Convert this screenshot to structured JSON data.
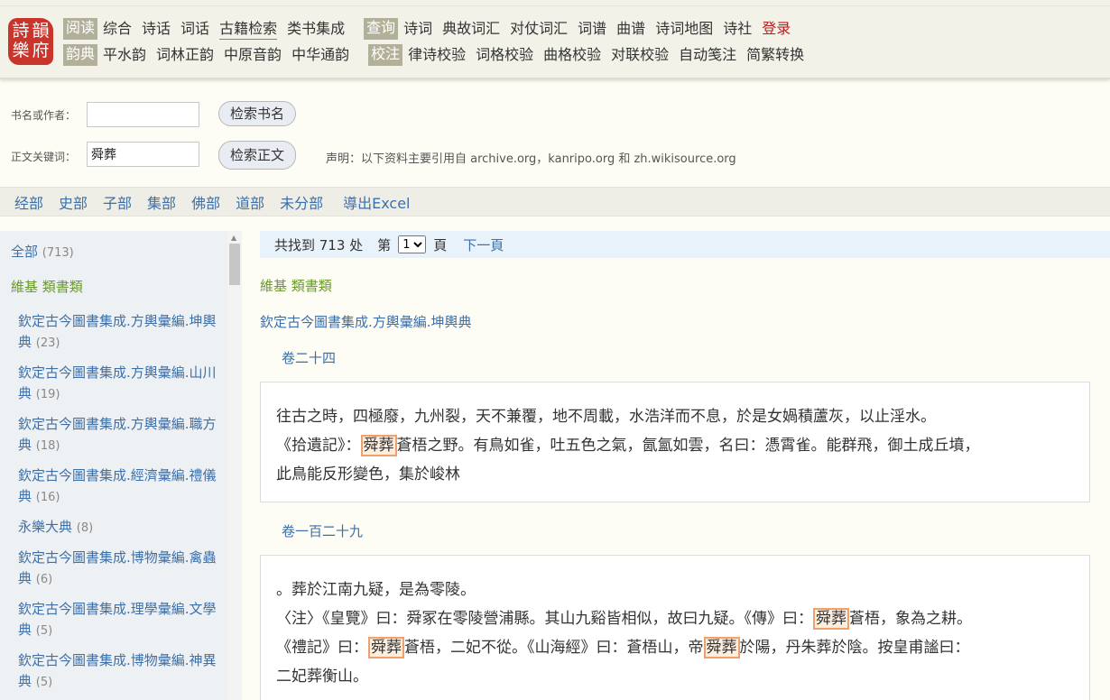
{
  "logo": {
    "glyphs": [
      "詩",
      "韻",
      "樂",
      "府"
    ]
  },
  "nav": {
    "row1": [
      {
        "label": "阅读",
        "pill": true
      },
      {
        "label": "综合"
      },
      {
        "label": "诗话"
      },
      {
        "label": "词话"
      },
      {
        "label": "古籍检索",
        "active": true
      },
      {
        "label": "类书集成"
      },
      {
        "label": "查询",
        "pill": true
      },
      {
        "label": "诗词"
      },
      {
        "label": "典故词汇"
      },
      {
        "label": "对仗词汇"
      },
      {
        "label": "词谱"
      },
      {
        "label": "曲谱"
      },
      {
        "label": "诗词地图"
      },
      {
        "label": "诗社"
      },
      {
        "label": "登录",
        "login": true
      }
    ],
    "row2": [
      {
        "label": "韵典",
        "pill": true
      },
      {
        "label": "平水韵"
      },
      {
        "label": "词林正韵"
      },
      {
        "label": "中原音韵"
      },
      {
        "label": "中华通韵"
      },
      {
        "label": "校注",
        "pill": true
      },
      {
        "label": "律诗校验"
      },
      {
        "label": "词格校验"
      },
      {
        "label": "曲格校验"
      },
      {
        "label": "对联校验"
      },
      {
        "label": "自动笺注"
      },
      {
        "label": "简繁转换"
      }
    ]
  },
  "search": {
    "title_label": "书名或作者：",
    "title_value": "",
    "title_button": "检索书名",
    "text_label": "正文关键词：",
    "text_value": "舜葬",
    "text_button": "检索正文",
    "notice": "声明：以下资料主要引用自 archive.org，kanripo.org 和 zh.wikisource.org"
  },
  "categories": [
    "经部",
    "史部",
    "子部",
    "集部",
    "佛部",
    "道部",
    "未分部"
  ],
  "export_label": "導出Excel",
  "sidebar": {
    "all_label": "全部",
    "all_count": "(713)",
    "group": "維基 類書類",
    "items": [
      {
        "name": "欽定古今圖書集成.方輿彙編.坤輿典",
        "count": "(23)"
      },
      {
        "name": "欽定古今圖書集成.方輿彙編.山川典",
        "count": "(19)"
      },
      {
        "name": "欽定古今圖書集成.方輿彙編.職方典",
        "count": "(18)"
      },
      {
        "name": "欽定古今圖書集成.經濟彙編.禮儀典",
        "count": "(16)"
      },
      {
        "name": "永樂大典",
        "count": "(8)"
      },
      {
        "name": "欽定古今圖書集成.博物彙編.禽蟲典",
        "count": "(6)"
      },
      {
        "name": "欽定古今圖書集成.理學彙編.文學典",
        "count": "(5)"
      },
      {
        "name": "欽定古今圖書集成.博物彙編.神異典",
        "count": "(5)"
      }
    ]
  },
  "results": {
    "found_prefix": "共找到 713 处",
    "page_prefix": "第",
    "page_value": "1",
    "page_suffix": "頁",
    "next_label": "下一頁",
    "group": "維基 類書類",
    "book": "欽定古今圖書集成.方輿彙編.坤輿典",
    "entries": [
      {
        "volume": "卷二十四",
        "segments": [
          {
            "t": "往古之時，四極廢，九州裂，天不兼覆，地不周載，水浩洋而不息，於是女媧積蘆灰，以止淫水。"
          },
          {
            "br": true
          },
          {
            "t": "《拾遺記》："
          },
          {
            "t": "舜葬",
            "hl": true
          },
          {
            "t": "蒼梧之野。有鳥如雀，吐五色之氣，氤氳如雲，名曰：憑霄雀。能群飛，御土成丘墳，"
          },
          {
            "br": true
          },
          {
            "t": "此鳥能反形變色，集於峻林"
          }
        ]
      },
      {
        "volume": "卷一百二十九",
        "segments": [
          {
            "t": "。葬於江南九疑，是為零陵。"
          },
          {
            "br": true
          },
          {
            "t": "〈注〉《皇覽》曰：舜冢在零陵營浦縣。其山九谿皆相似，故曰九疑。《傳》曰："
          },
          {
            "t": "舜葬",
            "hl": true
          },
          {
            "t": "蒼梧，象為之耕。"
          },
          {
            "br": true
          },
          {
            "t": "《禮記》曰："
          },
          {
            "t": "舜葬",
            "hl": true
          },
          {
            "t": "蒼梧，二妃不從。《山海經》曰：蒼梧山，帝"
          },
          {
            "t": "舜葬",
            "hl": true
          },
          {
            "t": "於陽，丹朱葬於陰。按皇甫謐曰："
          },
          {
            "br": true
          },
          {
            "t": "二妃葬衡山。"
          }
        ]
      }
    ]
  }
}
